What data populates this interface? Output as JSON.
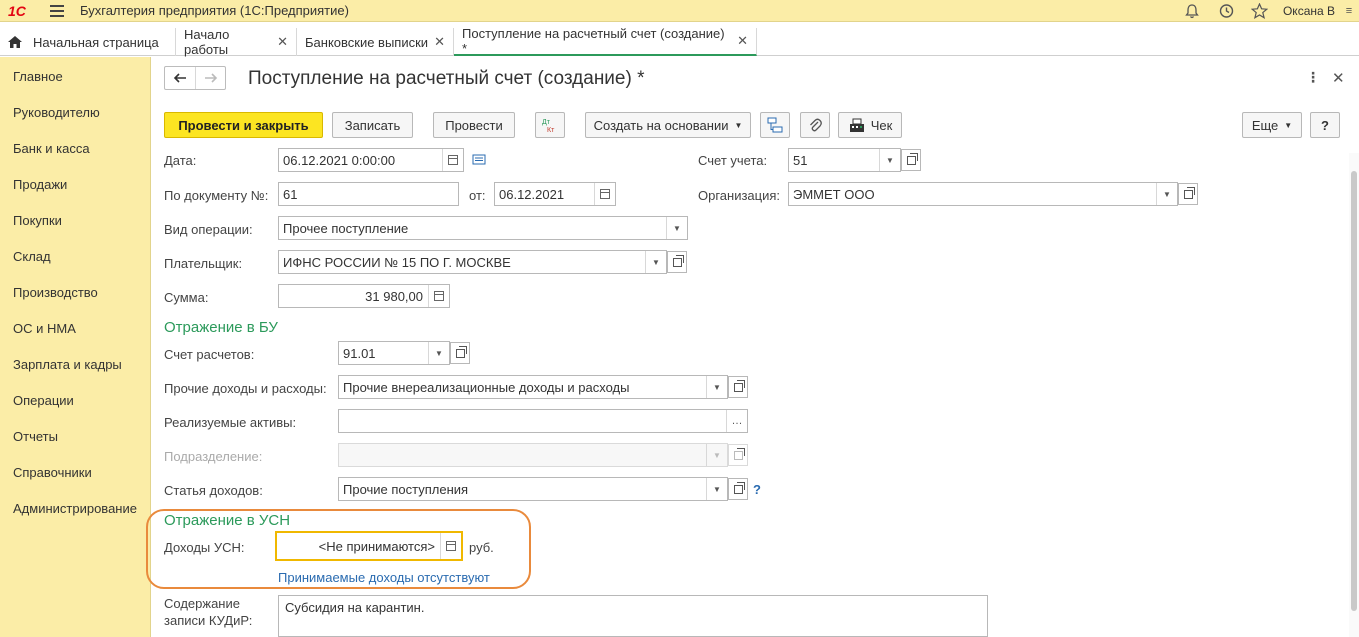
{
  "titlebar": {
    "logo": "1С",
    "title": "Бухгалтерия предприятия  (1С:Предприятие)",
    "user": "Оксана В"
  },
  "tabs": [
    {
      "label": "Начальная страница"
    },
    {
      "label": "Начало работы"
    },
    {
      "label": "Банковские выписки"
    },
    {
      "label": "Поступление на расчетный счет (создание) *"
    }
  ],
  "sidebar": {
    "items": [
      "Главное",
      "Руководителю",
      "Банк и касса",
      "Продажи",
      "Покупки",
      "Склад",
      "Производство",
      "ОС и НМА",
      "Зарплата и кадры",
      "Операции",
      "Отчеты",
      "Справочники",
      "Администрирование"
    ]
  },
  "form": {
    "title": "Поступление на расчетный счет (создание) *",
    "toolbar": {
      "post_close": "Провести и закрыть",
      "save": "Записать",
      "post": "Провести",
      "dtkt": "Дт Кт",
      "create_based": "Создать на основании",
      "receipt": "Чек",
      "more": "Еще",
      "help": "?"
    },
    "fields": {
      "date_label": "Дата:",
      "date_value": "06.12.2021  0:00:00",
      "doc_no_label": "По документу №:",
      "doc_no_value": "61",
      "from_label": "от:",
      "from_value": "06.12.2021",
      "account_label": "Счет учета:",
      "account_value": "51",
      "org_label": "Организация:",
      "org_value": "ЭММЕТ ООО",
      "op_type_label": "Вид операции:",
      "op_type_value": "Прочее поступление",
      "payer_label": "Плательщик:",
      "payer_value": "ИФНС РОССИИ № 15 ПО Г. МОСКВЕ",
      "sum_label": "Сумма:",
      "sum_value": "31 980,00"
    },
    "bu": {
      "header": "Отражение в БУ",
      "acc_label": "Счет расчетов:",
      "acc_value": "91.01",
      "other_label": "Прочие доходы и расходы:",
      "other_value": "Прочие внереализационные доходы и расходы",
      "assets_label": "Реализуемые активы:",
      "assets_value": "",
      "dept_label": "Подразделение:",
      "dept_value": "",
      "income_label": "Статья доходов:",
      "income_value": "Прочие поступления",
      "help": "?"
    },
    "usn": {
      "header": "Отражение в УСН",
      "income_label": "Доходы УСН:",
      "income_value": "<Не принимаются>",
      "currency": "руб.",
      "link": "Принимаемые доходы отсутствуют"
    },
    "kudir": {
      "label_line1": "Содержание",
      "label_line2": "записи КУДиР:",
      "value": "Субсидия на карантин."
    }
  },
  "colors": {
    "accent": "#fce522",
    "panel": "#fbeda7",
    "section_green": "#2c9a5b",
    "link_blue": "#2a6bb0",
    "highlight_orange": "#e98a3c"
  }
}
